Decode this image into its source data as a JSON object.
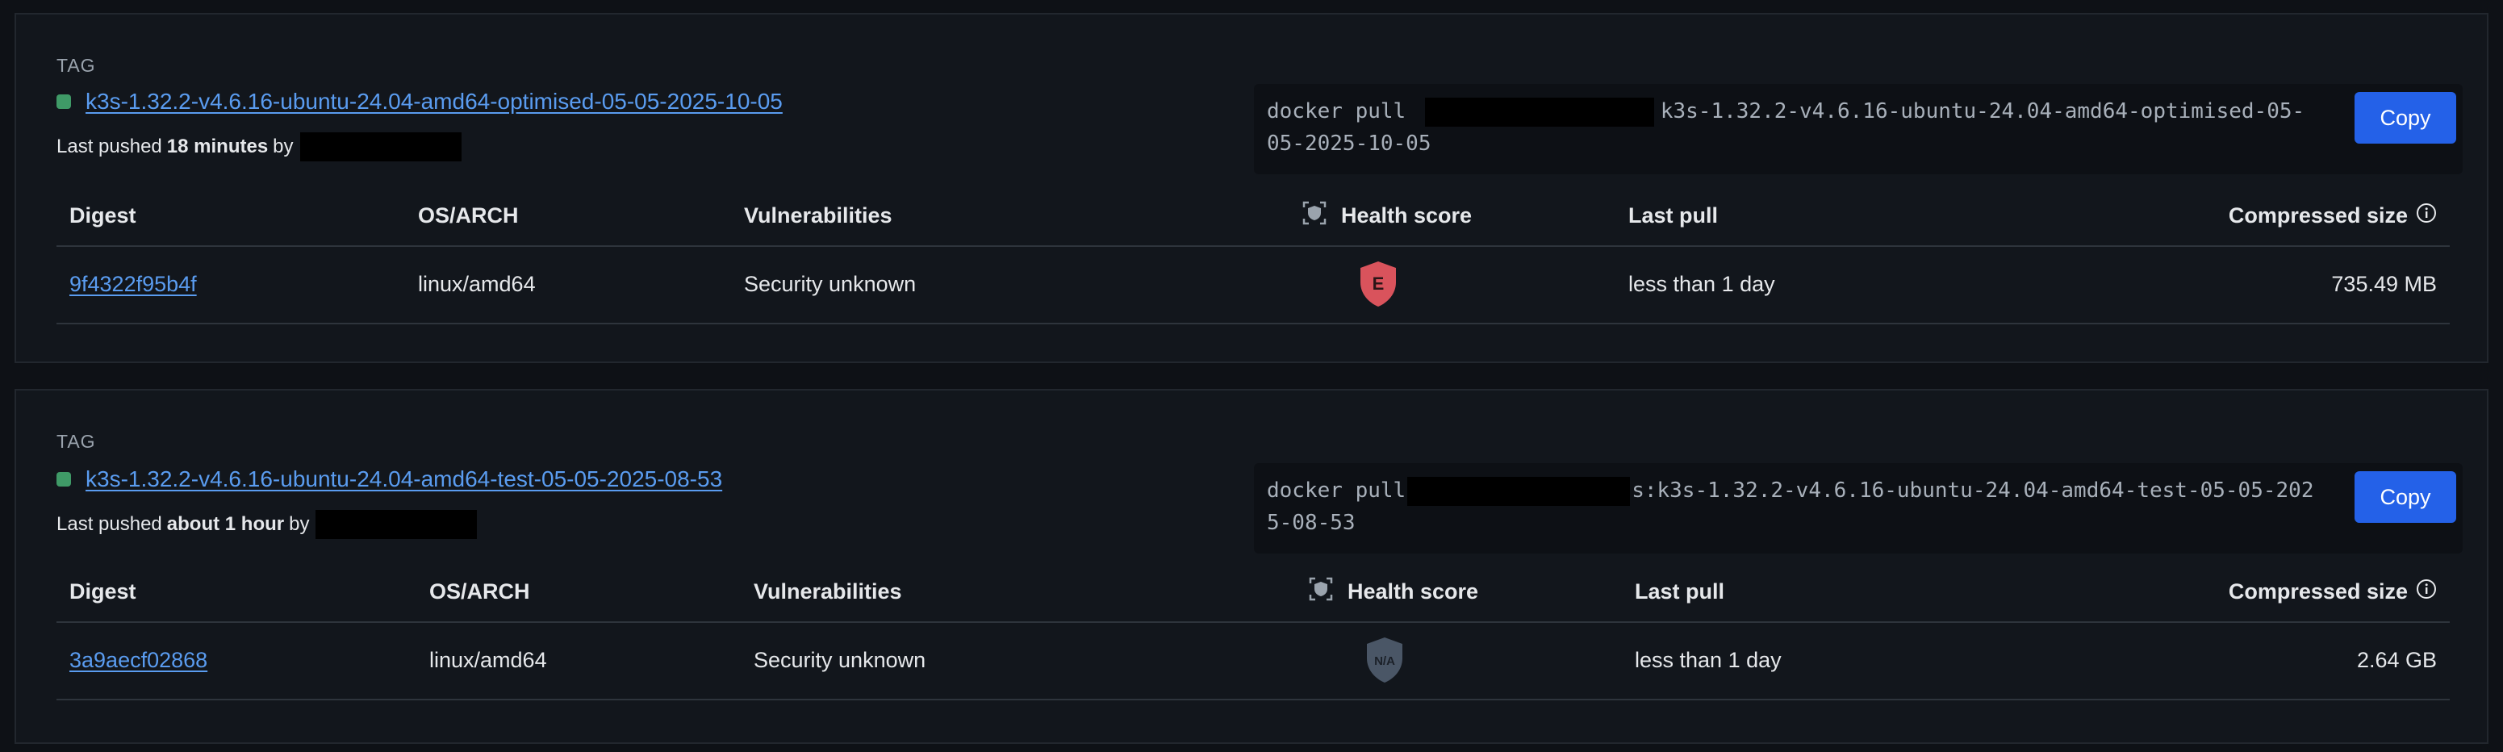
{
  "tags": [
    {
      "section_label": "TAG",
      "name": "k3s-1.32.2-v4.6.16-ubuntu-24.04-amd64-optimised-05-05-2025-10-05",
      "pushed_prefix": "Last pushed",
      "pushed_time": "18 minutes",
      "pushed_by": "by",
      "pull_prefix": "docker pull",
      "pull_suffix": "k3s-1.32.2-v4.6.16-ubuntu-24.04-amd64-optimised-05-05-2025-10-05",
      "copy_label": "Copy",
      "columns": {
        "digest": "Digest",
        "os_arch": "OS/ARCH",
        "vulnerabilities": "Vulnerabilities",
        "health_score": "Health score",
        "last_pull": "Last pull",
        "compressed_size": "Compressed size"
      },
      "row": {
        "digest": "9f4322f95b4f",
        "os_arch": "linux/amd64",
        "vulnerabilities": "Security unknown",
        "health_badge": "E",
        "health_color": "#d9535c",
        "last_pull": "less than 1 day",
        "compressed_size": "735.49 MB"
      }
    },
    {
      "section_label": "TAG",
      "name": "k3s-1.32.2-v4.6.16-ubuntu-24.04-amd64-test-05-05-2025-08-53",
      "pushed_prefix": "Last pushed",
      "pushed_time": "about 1 hour",
      "pushed_by": "by",
      "pull_prefix": "docker pull",
      "pull_suffix": "s:k3s-1.32.2-v4.6.16-ubuntu-24.04-amd64-test-05-05-2025-08-53",
      "copy_label": "Copy",
      "columns": {
        "digest": "Digest",
        "os_arch": "OS/ARCH",
        "vulnerabilities": "Vulnerabilities",
        "health_score": "Health score",
        "last_pull": "Last pull",
        "compressed_size": "Compressed size"
      },
      "row": {
        "digest": "3a9aecf02868",
        "os_arch": "linux/amd64",
        "vulnerabilities": "Security unknown",
        "health_badge": "N/A",
        "health_color": "#4a5666",
        "last_pull": "less than 1 day",
        "compressed_size": "2.64 GB"
      }
    }
  ],
  "colors": {
    "accent": "#2461e8",
    "link": "#5a9cf0",
    "tag_dot": "#3f9a67"
  },
  "icons": {
    "health": "health-score-icon",
    "info": "info-icon",
    "shield": "shield-badge-icon"
  }
}
